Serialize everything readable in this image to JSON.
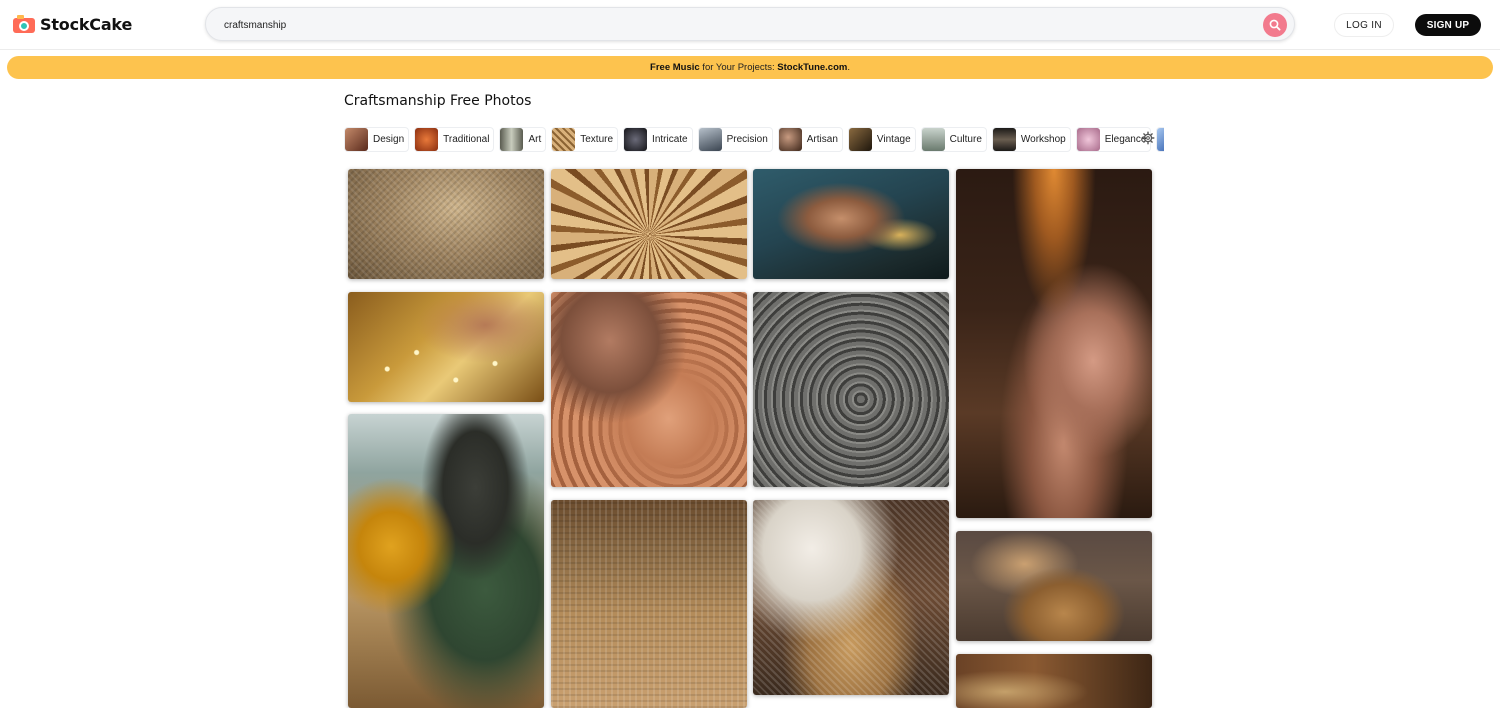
{
  "header": {
    "logo_text": "StockCake",
    "search": {
      "value": "craftsmanship",
      "placeholder": ""
    },
    "login_label": "LOG IN",
    "signup_label": "SIGN UP"
  },
  "banner": {
    "bold_1": "Free Music",
    "text_1": " for Your Projects: ",
    "link": "StockTune.com",
    "text_2": "."
  },
  "page_title": "Craftsmanship Free Photos",
  "tags": [
    {
      "label": "Design",
      "color": "#7a3b2a"
    },
    {
      "label": "Traditional",
      "color": "#b24a1c"
    },
    {
      "label": "Art",
      "color": "#8b8f7a"
    },
    {
      "label": "Texture",
      "color": "#c09a64"
    },
    {
      "label": "Intricate",
      "color": "#2a2a30"
    },
    {
      "label": "Precision",
      "color": "#5b6470"
    },
    {
      "label": "Artisan",
      "color": "#6d4a3a"
    },
    {
      "label": "Vintage",
      "color": "#4a3a24"
    },
    {
      "label": "Culture",
      "color": "#8a9a8e"
    },
    {
      "label": "Workshop",
      "color": "#3a3430"
    },
    {
      "label": "Elegance",
      "color": "#d9a7c1"
    },
    {
      "label": "",
      "color": "#3a7ad0"
    }
  ],
  "colors": {
    "banner": "#fdc34e",
    "search_button": "#f27a8d",
    "signup_bg": "#0c0c0c"
  },
  "photos": [
    "woven-sack",
    "wicker-basket",
    "hands-sewing",
    "hands-tool-tall",
    "jewelry-beads",
    "wood-carving",
    "carved-stone",
    "construction-worker",
    "woven-mat",
    "basket-weaver",
    "mallet-workshop",
    "carved-wood-partial"
  ]
}
